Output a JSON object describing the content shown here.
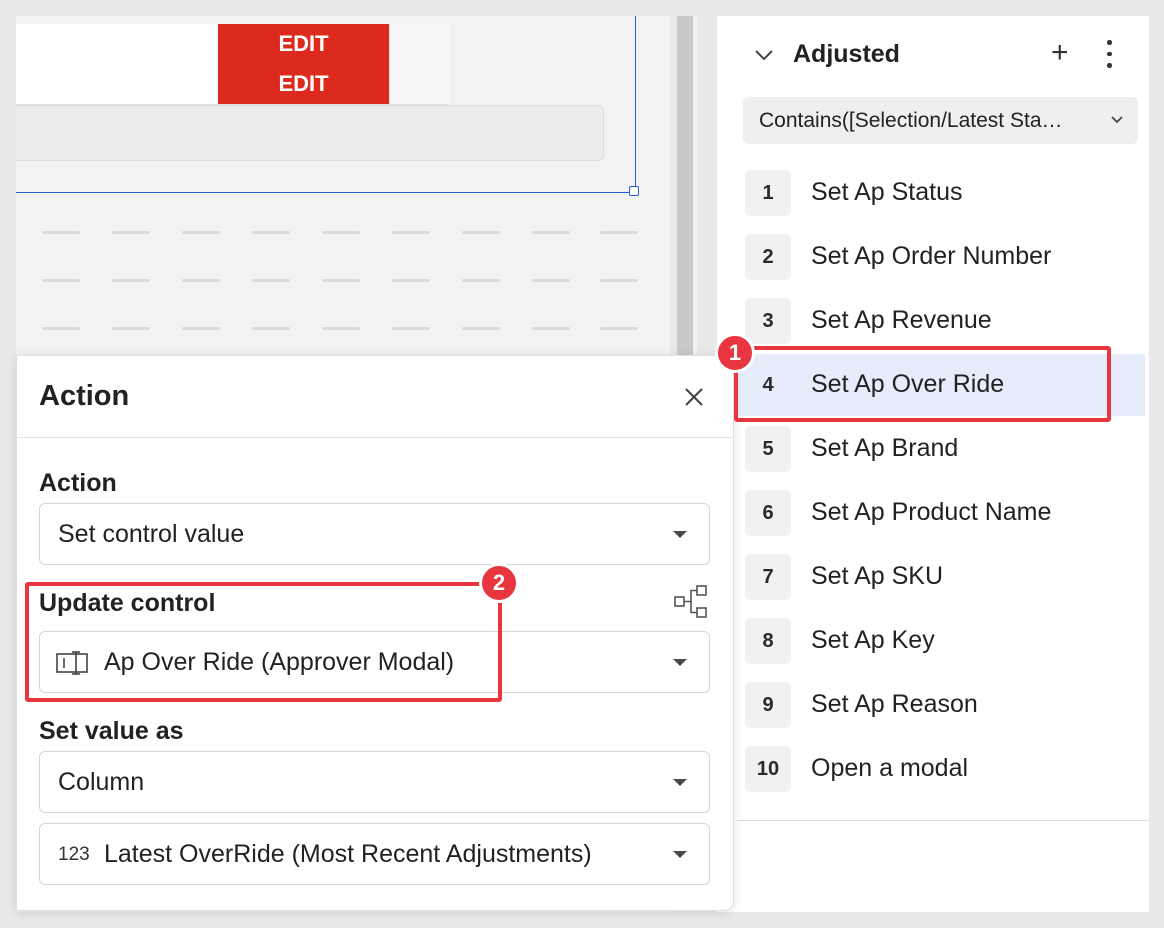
{
  "table": {
    "rows": [
      {
        "action_label": "EDIT"
      },
      {
        "action_label": "EDIT"
      }
    ]
  },
  "colors": {
    "edit_button": "#dc2a1f",
    "selection": "#2460d0",
    "annotation": "#e8353f",
    "active_step": "#e6ecfa"
  },
  "actions_panel": {
    "title": "Adjusted",
    "add_icon": "plus-icon",
    "menu_icon": "kebab-icon",
    "condition": "Contains([Selection/Latest Sta…",
    "steps": [
      {
        "num": "1",
        "label": "Set Ap Status"
      },
      {
        "num": "2",
        "label": "Set Ap Order Number"
      },
      {
        "num": "3",
        "label": "Set Ap Revenue"
      },
      {
        "num": "4",
        "label": "Set Ap Over Ride"
      },
      {
        "num": "5",
        "label": "Set Ap Brand"
      },
      {
        "num": "6",
        "label": "Set Ap Product Name"
      },
      {
        "num": "7",
        "label": "Set Ap SKU"
      },
      {
        "num": "8",
        "label": "Set Ap Key"
      },
      {
        "num": "9",
        "label": "Set Ap Reason"
      },
      {
        "num": "10",
        "label": "Open a modal"
      }
    ],
    "active_step": "4"
  },
  "modal": {
    "title": "Action",
    "action_label": "Action",
    "action_value": "Set control value",
    "update_control_label": "Update control",
    "update_control_value": "Ap Over Ride (Approver Modal)",
    "set_value_as_label": "Set value as",
    "set_value_as_value": "Column",
    "column_type_glyph": "123",
    "column_value": "Latest OverRide (Most Recent Adjustments)"
  },
  "annotations": {
    "badge_1": "1",
    "badge_2": "2"
  }
}
